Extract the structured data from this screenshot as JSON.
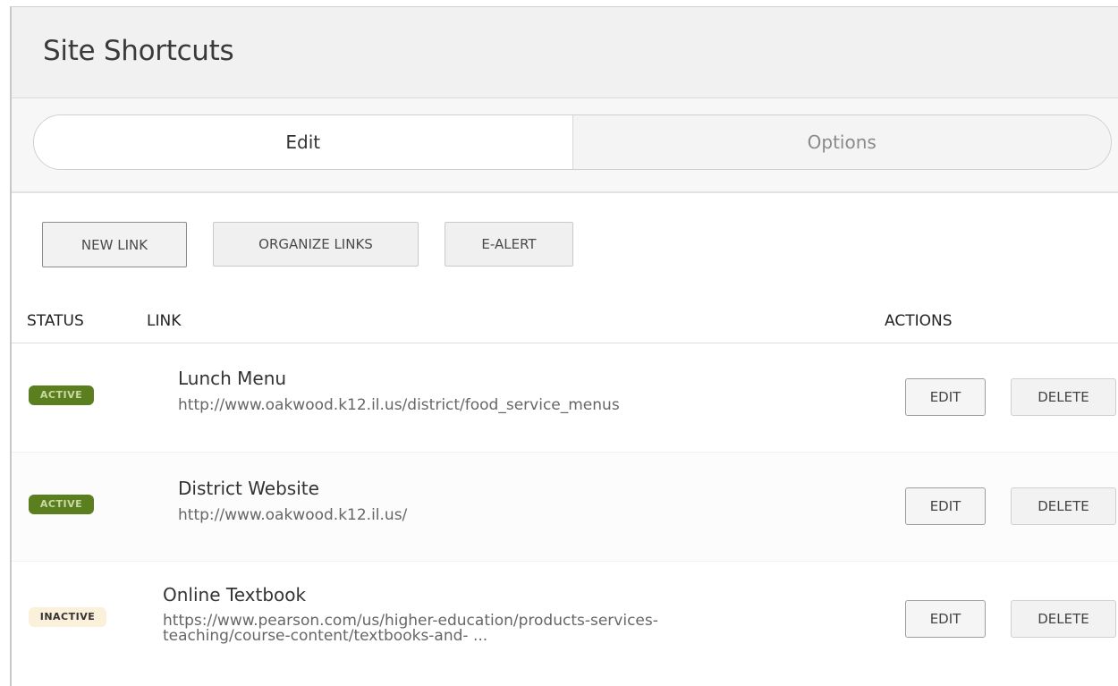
{
  "header": {
    "title": "Site Shortcuts"
  },
  "tabs": [
    {
      "label": "Edit",
      "active": true
    },
    {
      "label": "Options",
      "active": false
    }
  ],
  "toolbar": {
    "new_link": "NEW LINK",
    "organize_links": "ORGANIZE LINKS",
    "e_alert": "E-ALERT"
  },
  "columns": {
    "status": "STATUS",
    "link": "LINK",
    "actions": "ACTIONS"
  },
  "rows": [
    {
      "status": "ACTIVE",
      "name": "Lunch Menu",
      "url": "http://www.oakwood.k12.il.us/district/food_service_menus",
      "edit": "EDIT",
      "delete": "DELETE"
    },
    {
      "status": "ACTIVE",
      "name": "District Website",
      "url": "http://www.oakwood.k12.il.us/",
      "edit": "EDIT",
      "delete": "DELETE"
    },
    {
      "status": "INACTIVE",
      "name": "Online Textbook",
      "url_line1": "https://www.pearson.com/us/higher-education/products-services-",
      "url_line2": "teaching/course-content/textbooks-and- ...",
      "edit": "EDIT",
      "delete": "DELETE"
    }
  ],
  "colors": {
    "active_badge": "#5b7f1e",
    "inactive_badge": "#fbf0d9",
    "header_bg": "#f1f1f1"
  }
}
